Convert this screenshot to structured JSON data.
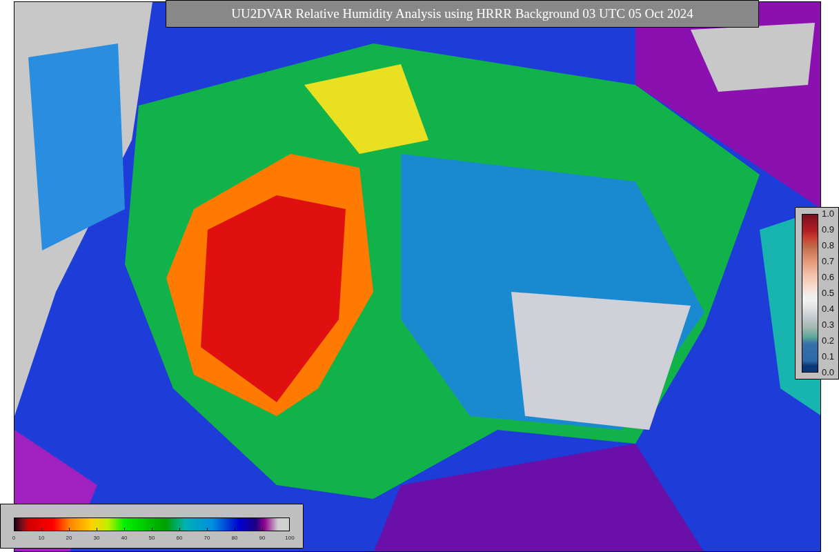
{
  "title": "UU2DVAR Relative Humidity Analysis using HRRR Background 03 UTC 05 Oct 2024",
  "humidity_colorbar": {
    "tick_labels": [
      "0",
      "10",
      "20",
      "30",
      "40",
      "50",
      "60",
      "70",
      "80",
      "90",
      "100"
    ]
  },
  "ratio_colorbar": {
    "tick_labels": [
      "1.0",
      "0.9",
      "0.8",
      "0.7",
      "0.6",
      "0.5",
      "0.4",
      "0.3",
      "0.2",
      "0.1",
      "0.0"
    ]
  }
}
